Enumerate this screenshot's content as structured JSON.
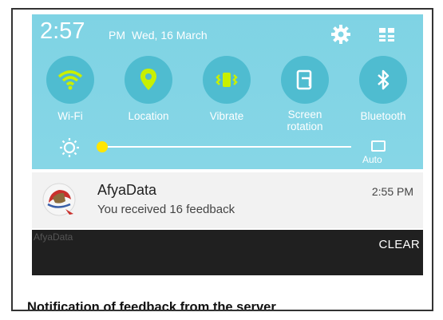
{
  "status_bar": {
    "time": "2:57",
    "ampm": "PM",
    "date": "Wed, 16 March",
    "settings_icon": "gear-icon",
    "quick_panel_icon": "grid-icon"
  },
  "quick_toggles": [
    {
      "label": "Wi-Fi",
      "icon": "wifi-icon",
      "active": true
    },
    {
      "label": "Location",
      "icon": "location-pin-icon",
      "active": true
    },
    {
      "label": "Vibrate",
      "icon": "vibrate-icon",
      "active": true
    },
    {
      "label": "Screen\nrotation",
      "icon": "screen-rotation-icon",
      "active": false
    },
    {
      "label": "Bluetooth",
      "icon": "bluetooth-icon",
      "active": false
    }
  ],
  "brightness": {
    "icon": "brightness-sun-icon",
    "level": 0.0,
    "auto_label": "Auto"
  },
  "notification": {
    "app_name": "AfyaData",
    "message": "You received 16 feedback",
    "time": "2:55 PM"
  },
  "footer": {
    "ghost_label": "AfyaData",
    "clear_label": "CLEAR"
  },
  "caption": "Notification of feedback from the server",
  "colors": {
    "shade": "#7fd3e4",
    "toggle_circle": "#4fbcd0",
    "active_icon": "#c8f000",
    "knob": "#ffe600"
  }
}
